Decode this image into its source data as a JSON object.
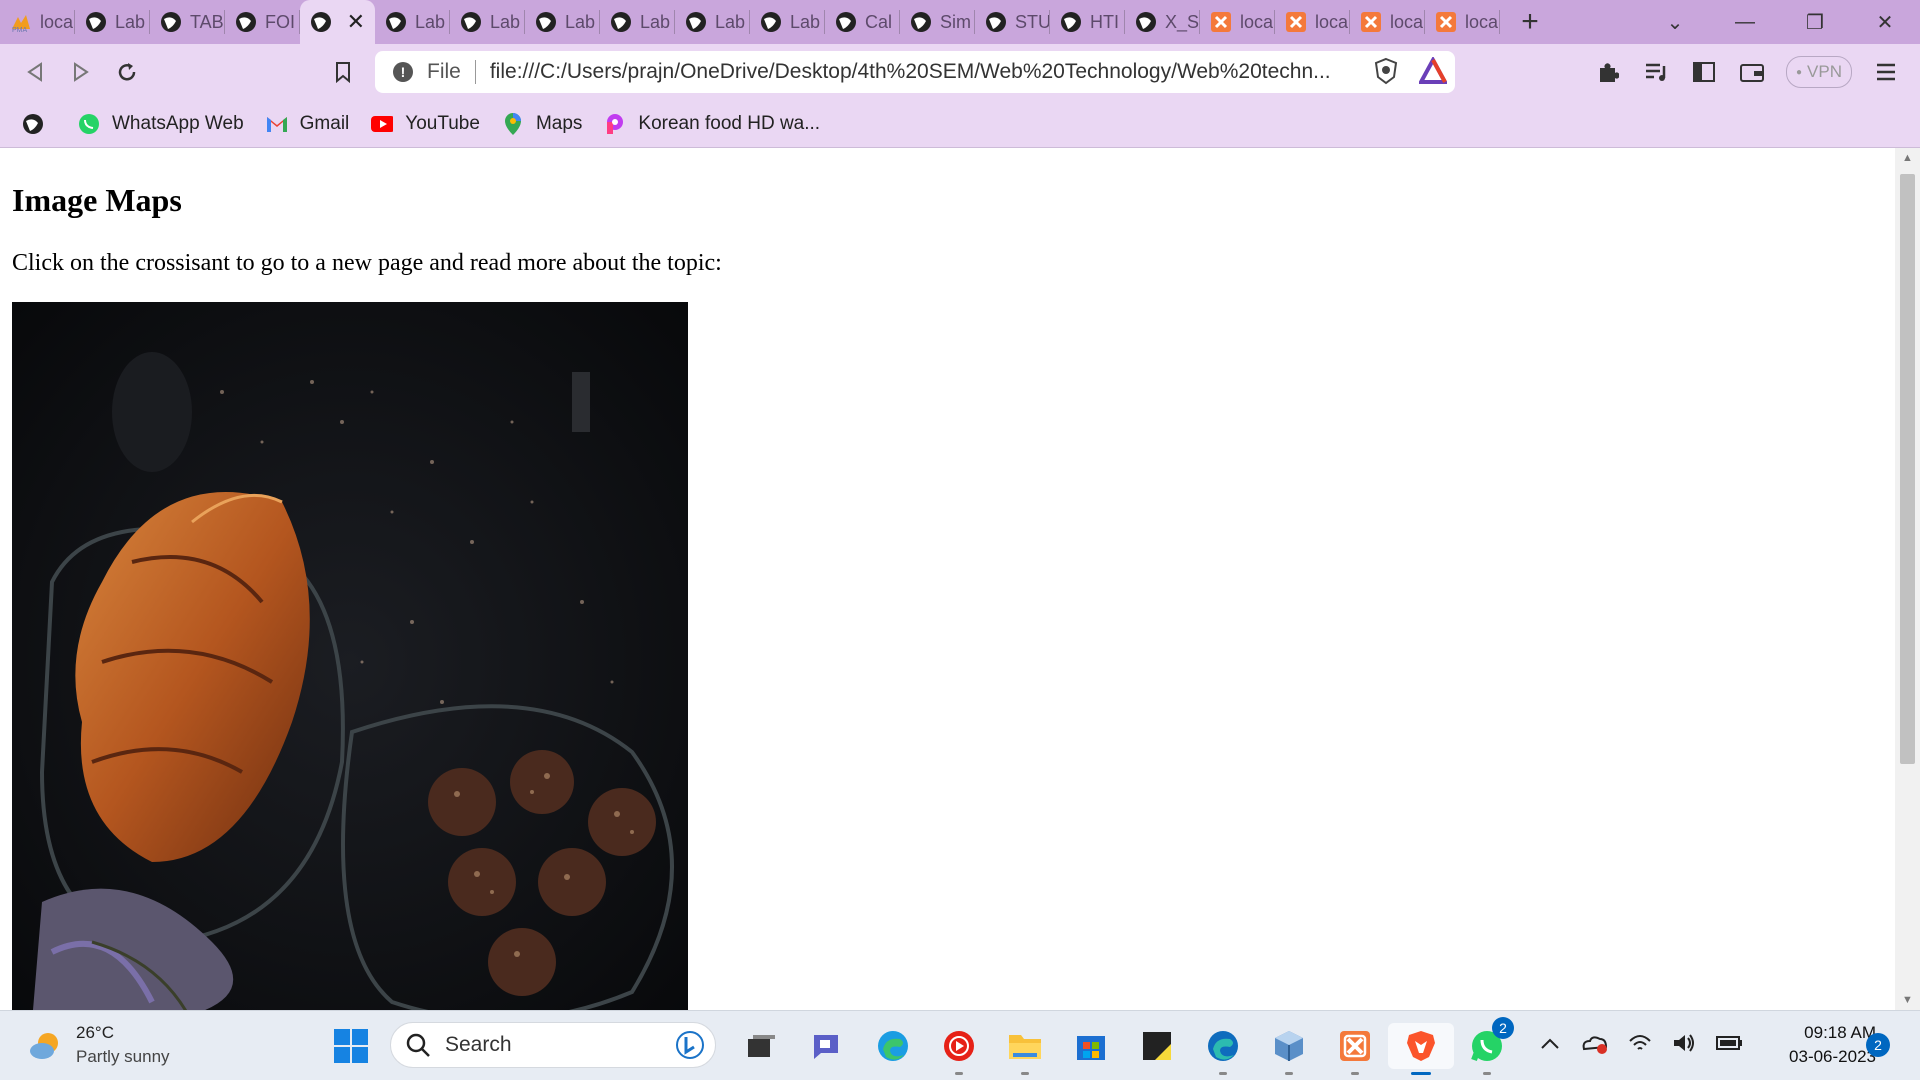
{
  "browser": {
    "tabs": [
      {
        "label": "loca",
        "icon": "phpmyadmin-icon"
      },
      {
        "label": "Lab",
        "icon": "globe-icon"
      },
      {
        "label": "TAB",
        "icon": "globe-icon"
      },
      {
        "label": "FOI",
        "icon": "globe-icon"
      },
      {
        "label": "",
        "icon": "globe-icon",
        "active": true
      },
      {
        "label": "Lab",
        "icon": "globe-icon"
      },
      {
        "label": "Lab",
        "icon": "globe-icon"
      },
      {
        "label": "Lab",
        "icon": "globe-icon"
      },
      {
        "label": "Lab",
        "icon": "globe-icon"
      },
      {
        "label": "Lab",
        "icon": "globe-icon"
      },
      {
        "label": "Lab",
        "icon": "globe-icon"
      },
      {
        "label": "Cal",
        "icon": "globe-icon"
      },
      {
        "label": "Sim",
        "icon": "globe-icon"
      },
      {
        "label": "STU",
        "icon": "globe-icon"
      },
      {
        "label": "HTI",
        "icon": "globe-icon"
      },
      {
        "label": "X_S",
        "icon": "globe-icon"
      },
      {
        "label": "loca",
        "icon": "xampp-icon"
      },
      {
        "label": "loca",
        "icon": "xampp-icon"
      },
      {
        "label": "loca",
        "icon": "xampp-icon"
      },
      {
        "label": "loca",
        "icon": "xampp-icon"
      }
    ],
    "address": {
      "scheme_label": "File",
      "url": "file:///C:/Users/prajn/OneDrive/Desktop/4th%20SEM/Web%20Technology/Web%20techn..."
    },
    "vpn_label": "VPN",
    "bookmarks": [
      {
        "label": "",
        "icon": "globe-icon"
      },
      {
        "label": "WhatsApp Web",
        "icon": "whatsapp-icon"
      },
      {
        "label": "Gmail",
        "icon": "gmail-icon"
      },
      {
        "label": "YouTube",
        "icon": "youtube-icon"
      },
      {
        "label": "Maps",
        "icon": "maps-icon"
      },
      {
        "label": "Korean food HD wa...",
        "icon": "picsart-icon"
      }
    ]
  },
  "page": {
    "heading": "Image Maps",
    "instruction": "Click on the crossisant to go to a new page and read more about the topic:"
  },
  "taskbar": {
    "weather": {
      "temp": "26°C",
      "condition": "Partly sunny"
    },
    "search_placeholder": "Search",
    "clock": {
      "time": "09:18 AM",
      "date": "03-06-2023"
    },
    "notification_count": "2",
    "whatsapp_badge": "2"
  }
}
